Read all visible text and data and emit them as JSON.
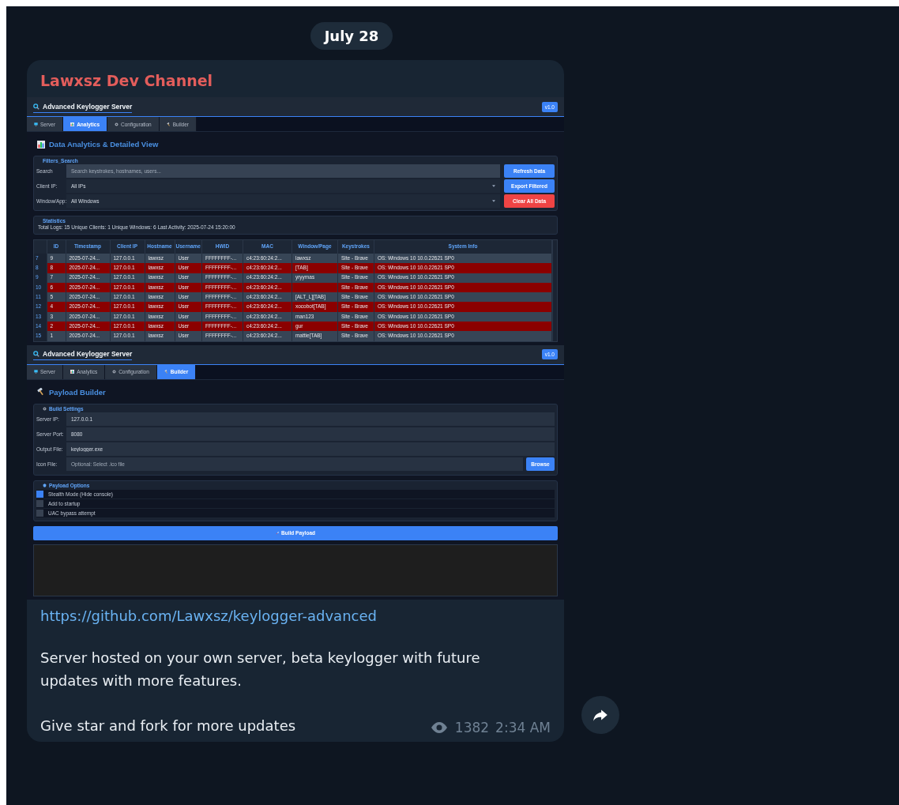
{
  "date_pill": "July 28",
  "message": {
    "channel": "Lawxsz Dev Channel",
    "screenshots": [
      {
        "kind": "analytics",
        "title": "Advanced Keylogger Server",
        "badge": "v1.0",
        "tabs": [
          {
            "label": "Server",
            "selected": false
          },
          {
            "label": "Analytics",
            "selected": true
          },
          {
            "label": "Configuration",
            "selected": false
          },
          {
            "label": "Builder",
            "selected": false
          }
        ],
        "heading": "Data Analytics & Detailed View",
        "filters": {
          "legend": "Filters_Search",
          "fields": [
            {
              "label": "Search",
              "placeholder": "Search keystrokes, hostnames, users...",
              "kind": "text"
            },
            {
              "label": "Client IP:",
              "value": "All IPs",
              "kind": "select"
            },
            {
              "label": "Window/App:",
              "value": "All Windows",
              "kind": "select"
            }
          ],
          "buttons": [
            {
              "label": "Refresh Data",
              "kind": "primary"
            },
            {
              "label": "Export Filtered",
              "kind": "primary"
            },
            {
              "label": "Clear All Data",
              "kind": "danger"
            }
          ]
        },
        "statistics": {
          "legend": "Statistics",
          "text": "Total Logs: 15  Unique Clients: 1  Unique Windows: 6  Last Activity: 2025-07-24 15:20:00"
        },
        "table": {
          "columns": [
            "ID",
            "Timestamp",
            "Client IP",
            "Hostname",
            "Username",
            "HWID",
            "MAC",
            "Window/Page",
            "Keystrokes",
            "System Info"
          ],
          "rows": [
            {
              "row": "7",
              "highlighted": false,
              "cells": [
                "9",
                "2025-07-24...",
                "127.0.0.1",
                "lawxsz",
                "User",
                "FFFFFFFF-...",
                "c4:23:60:24:2...",
                "lawxsz",
                "Site - Brave",
                "OS: Windows 10 10.0.22621 SP0"
              ]
            },
            {
              "row": "8",
              "highlighted": true,
              "cells": [
                "8",
                "2025-07-24...",
                "127.0.0.1",
                "lawxsz",
                "User",
                "FFFFFFFF-...",
                "c4:23:60:24:2...",
                "[TAB]",
                "Site - Brave",
                "OS: Windows 10 10.0.22621 SP0"
              ]
            },
            {
              "row": "9",
              "highlighted": false,
              "cells": [
                "7",
                "2025-07-24...",
                "127.0.0.1",
                "lawxsz",
                "User",
                "FFFFFFFF-...",
                "c4:23:60:24:2...",
                "yryymas",
                "Site - Brave",
                "OS: Windows 10 10.0.22621 SP0"
              ]
            },
            {
              "row": "10",
              "highlighted": true,
              "cells": [
                "6",
                "2025-07-24...",
                "127.0.0.1",
                "lawxsz",
                "User",
                "FFFFFFFF-...",
                "c4:23:60:24:2...",
                "",
                "Site - Brave",
                "OS: Windows 10 10.0.22621 SP0"
              ]
            },
            {
              "row": "11",
              "highlighted": false,
              "cells": [
                "5",
                "2025-07-24...",
                "127.0.0.1",
                "lawxsz",
                "User",
                "FFFFFFFF-...",
                "c4:23:60:24:2...",
                "[ALT_L][TAB]",
                "Site - Brave",
                "OS: Windows 10 10.0.22621 SP0"
              ]
            },
            {
              "row": "12",
              "highlighted": true,
              "cells": [
                "4",
                "2025-07-24...",
                "127.0.0.1",
                "lawxsz",
                "User",
                "FFFFFFFF-...",
                "c4:23:60:24:2...",
                "xocobot[TAB]",
                "Site - Brave",
                "OS: Windows 10 10.0.22621 SP0"
              ]
            },
            {
              "row": "13",
              "highlighted": false,
              "cells": [
                "3",
                "2025-07-24...",
                "127.0.0.1",
                "lawxsz",
                "User",
                "FFFFFFFF-...",
                "c4:23:60:24:2...",
                "man123",
                "Site - Brave",
                "OS: Windows 10 10.0.22621 SP0"
              ]
            },
            {
              "row": "14",
              "highlighted": true,
              "cells": [
                "2",
                "2025-07-24...",
                "127.0.0.1",
                "lawxsz",
                "User",
                "FFFFFFFF-...",
                "c4:23:60:24:2...",
                "gur",
                "Site - Brave",
                "OS: Windows 10 10.0.22621 SP0"
              ]
            },
            {
              "row": "15",
              "highlighted": false,
              "cells": [
                "1",
                "2025-07-24...",
                "127.0.0.1",
                "lawxsz",
                "User",
                "FFFFFFFF-...",
                "c4:23:60:24:2...",
                "mattie[TAB]",
                "Site - Brave",
                "OS: Windows 10 10.0.22621 SP0"
              ]
            }
          ]
        }
      },
      {
        "kind": "builder",
        "title": "Advanced Keylogger Server",
        "badge": "v1.0",
        "tabs": [
          {
            "label": "Server",
            "selected": false
          },
          {
            "label": "Analytics",
            "selected": false
          },
          {
            "label": "Configuration",
            "selected": false
          },
          {
            "label": "Builder",
            "selected": true
          }
        ],
        "heading": "Payload Builder",
        "settings": {
          "legend": "Build Settings",
          "fields": [
            {
              "label": "Server IP:",
              "value": "127.0.0.1"
            },
            {
              "label": "Server Port:",
              "value": "8080"
            },
            {
              "label": "Output File:",
              "value": "keylogger.exe"
            },
            {
              "label": "Icon File:",
              "placeholder": "Optional: Select .ico file",
              "button": "Browse"
            }
          ]
        },
        "options": {
          "legend": "Payload Options",
          "items": [
            {
              "label": "Stealth Mode (Hide console)",
              "checked": true
            },
            {
              "label": "Add to startup",
              "checked": false
            },
            {
              "label": "UAC bypass attempt",
              "checked": false
            }
          ]
        },
        "build_button": "Build Payload"
      }
    ],
    "link": "https://github.com/Lawxsz/keylogger-advanced",
    "paragraphs": [
      "Server hosted on your own server, beta keylogger with future updates with more features.",
      "Give star and fork for more updates"
    ],
    "views": "1382",
    "time": "2:34 AM"
  }
}
